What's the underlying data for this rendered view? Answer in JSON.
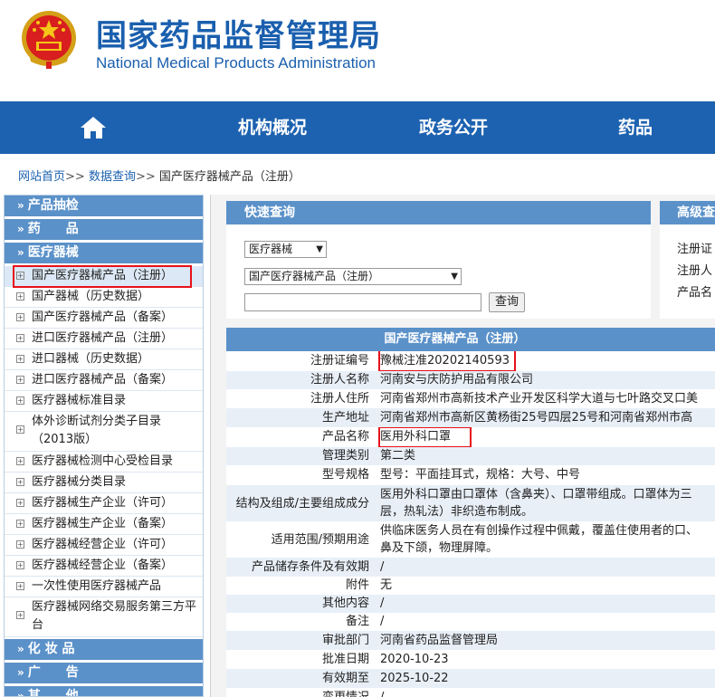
{
  "header": {
    "title_cn": "国家药品监督管理局",
    "title_en": "National Medical Products Administration",
    "emblem_icon": "national-emblem-icon",
    "colors": {
      "brand": "#1a5fae",
      "nav": "#1d62b0",
      "section": "#5b91c9",
      "highlight": "#e8101a"
    }
  },
  "nav": {
    "home_icon": "home-icon",
    "items": [
      {
        "label": "机构概况"
      },
      {
        "label": "政务公开"
      },
      {
        "label": "药品"
      }
    ]
  },
  "breadcrumb": {
    "home": "网站首页",
    "data": "数据查询",
    "current": "国产医疗器械产品（注册）",
    "sep": ">>"
  },
  "sidebar": {
    "categories": [
      {
        "label": "产品抽检"
      },
      {
        "label": "药　　品"
      },
      {
        "label": "医疗器械"
      },
      {
        "label": "化 妆 品"
      },
      {
        "label": "广　　告"
      },
      {
        "label": "其　　他"
      }
    ],
    "items": [
      {
        "label": "国产医疗器械产品（注册）"
      },
      {
        "label": "国产器械（历史数据）"
      },
      {
        "label": "国产医疗器械产品（备案）"
      },
      {
        "label": "进口医疗器械产品（注册）"
      },
      {
        "label": "进口器械（历史数据）"
      },
      {
        "label": "进口医疗器械产品（备案）"
      },
      {
        "label": "医疗器械标准目录"
      },
      {
        "label": "体外诊断试剂分类子目录（2013版）"
      },
      {
        "label": "医疗器械检测中心受检目录"
      },
      {
        "label": "医疗器械分类目录"
      },
      {
        "label": "医疗器械生产企业（许可）"
      },
      {
        "label": "医疗器械生产企业（备案）"
      },
      {
        "label": "医疗器械经营企业（许可）"
      },
      {
        "label": "医疗器械经营企业（备案）"
      },
      {
        "label": "一次性使用医疗器械产品"
      },
      {
        "label": "医疗器械网络交易服务第三方平台"
      }
    ]
  },
  "quick_search": {
    "title": "快速查询",
    "select1": "医疗器械",
    "select2": "国产医疗器械产品（注册）",
    "input_value": "",
    "button": "查询"
  },
  "advanced_search": {
    "title": "高级查",
    "fields": [
      "注册证",
      "注册人",
      "产品名"
    ]
  },
  "detail": {
    "title": "国产医疗器械产品（注册）",
    "rows": [
      {
        "label": "注册证编号",
        "value": "豫械注准20202140593"
      },
      {
        "label": "注册人名称",
        "value": "河南安与庆防护用品有限公司"
      },
      {
        "label": "注册人住所",
        "value": "河南省郑州市高新技术产业开发区科学大道与七叶路交叉口美"
      },
      {
        "label": "生产地址",
        "value": "河南省郑州市高新区黄杨街25号四层25号和河南省郑州市高"
      },
      {
        "label": "产品名称",
        "value": "医用外科口罩"
      },
      {
        "label": "管理类别",
        "value": "第二类"
      },
      {
        "label": "型号规格",
        "value": "型号：平面挂耳式，规格：大号、中号"
      },
      {
        "label": "结构及组成/主要组成成分",
        "value": "医用外科口罩由口罩体（含鼻夹）、口罩带组成。口罩体为三层，热轧法）非织造布制成。"
      },
      {
        "label": "适用范围/预期用途",
        "value": "供临床医务人员在有创操作过程中佩戴，覆盖住使用者的口、鼻及下颌，物理屏障。"
      },
      {
        "label": "产品储存条件及有效期",
        "value": "/"
      },
      {
        "label": "附件",
        "value": "无"
      },
      {
        "label": "其他内容",
        "value": "/"
      },
      {
        "label": "备注",
        "value": "/"
      },
      {
        "label": "审批部门",
        "value": "河南省药品监督管理局"
      },
      {
        "label": "批准日期",
        "value": "2020-10-23"
      },
      {
        "label": "有效期至",
        "value": "2025-10-22"
      },
      {
        "label": "变更情况",
        "value": "/"
      }
    ]
  }
}
